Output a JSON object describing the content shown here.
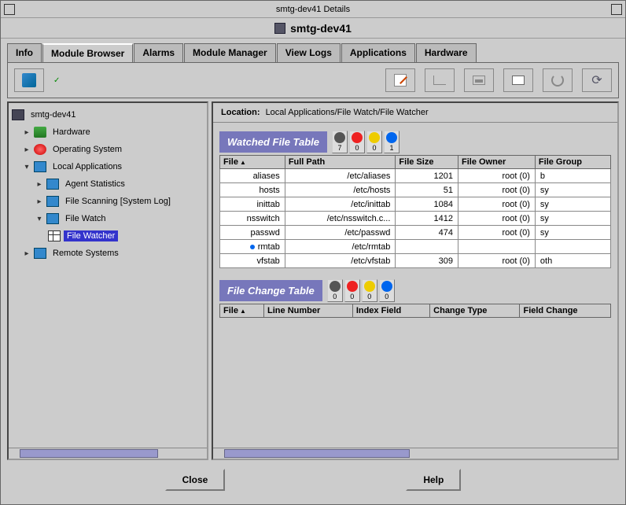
{
  "window": {
    "title": "smtg-dev41 Details",
    "subtitle": "smtg-dev41"
  },
  "tabs": [
    {
      "label": "Info"
    },
    {
      "label": "Module Browser"
    },
    {
      "label": "Alarms"
    },
    {
      "label": "Module Manager"
    },
    {
      "label": "View Logs"
    },
    {
      "label": "Applications"
    },
    {
      "label": "Hardware"
    }
  ],
  "tree": {
    "root": "smtg-dev41",
    "hardware": "Hardware",
    "os": "Operating System",
    "local_apps": "Local Applications",
    "agent_stats": "Agent Statistics",
    "file_scan": "File Scanning [System Log]",
    "file_watch": "File Watch",
    "file_watcher": "File Watcher",
    "remote": "Remote Systems"
  },
  "location": {
    "label": "Location:",
    "path": "Local Applications/File Watch/File Watcher"
  },
  "watched": {
    "title": "Watched File Table",
    "alarms": [
      "7",
      "0",
      "0",
      "1"
    ],
    "headers": {
      "file": "File",
      "path": "Full Path",
      "size": "File Size",
      "owner": "File Owner",
      "group": "File Group"
    },
    "rows": [
      {
        "file": "aliases",
        "path": "/etc/aliases",
        "size": "1201",
        "owner": "root (0)",
        "group": "b"
      },
      {
        "file": "hosts",
        "path": "/etc/hosts",
        "size": "51",
        "owner": "root (0)",
        "group": "sy"
      },
      {
        "file": "inittab",
        "path": "/etc/inittab",
        "size": "1084",
        "owner": "root (0)",
        "group": "sy"
      },
      {
        "file": "nsswitch",
        "path": "/etc/nsswitch.c...",
        "size": "1412",
        "owner": "root (0)",
        "group": "sy"
      },
      {
        "file": "passwd",
        "path": "/etc/passwd",
        "size": "474",
        "owner": "root (0)",
        "group": "sy"
      },
      {
        "file": "rmtab",
        "path": "/etc/rmtab",
        "size": "",
        "owner": "",
        "group": "",
        "marker": true
      },
      {
        "file": "vfstab",
        "path": "/etc/vfstab",
        "size": "309",
        "owner": "root (0)",
        "group": "oth"
      }
    ]
  },
  "changes": {
    "title": "File Change Table",
    "alarms": [
      "0",
      "0",
      "0",
      "0"
    ],
    "headers": {
      "file": "File",
      "line": "Line Number",
      "index": "Index Field",
      "change": "Change Type",
      "field": "Field Change"
    }
  },
  "footer": {
    "close": "Close",
    "help": "Help"
  }
}
